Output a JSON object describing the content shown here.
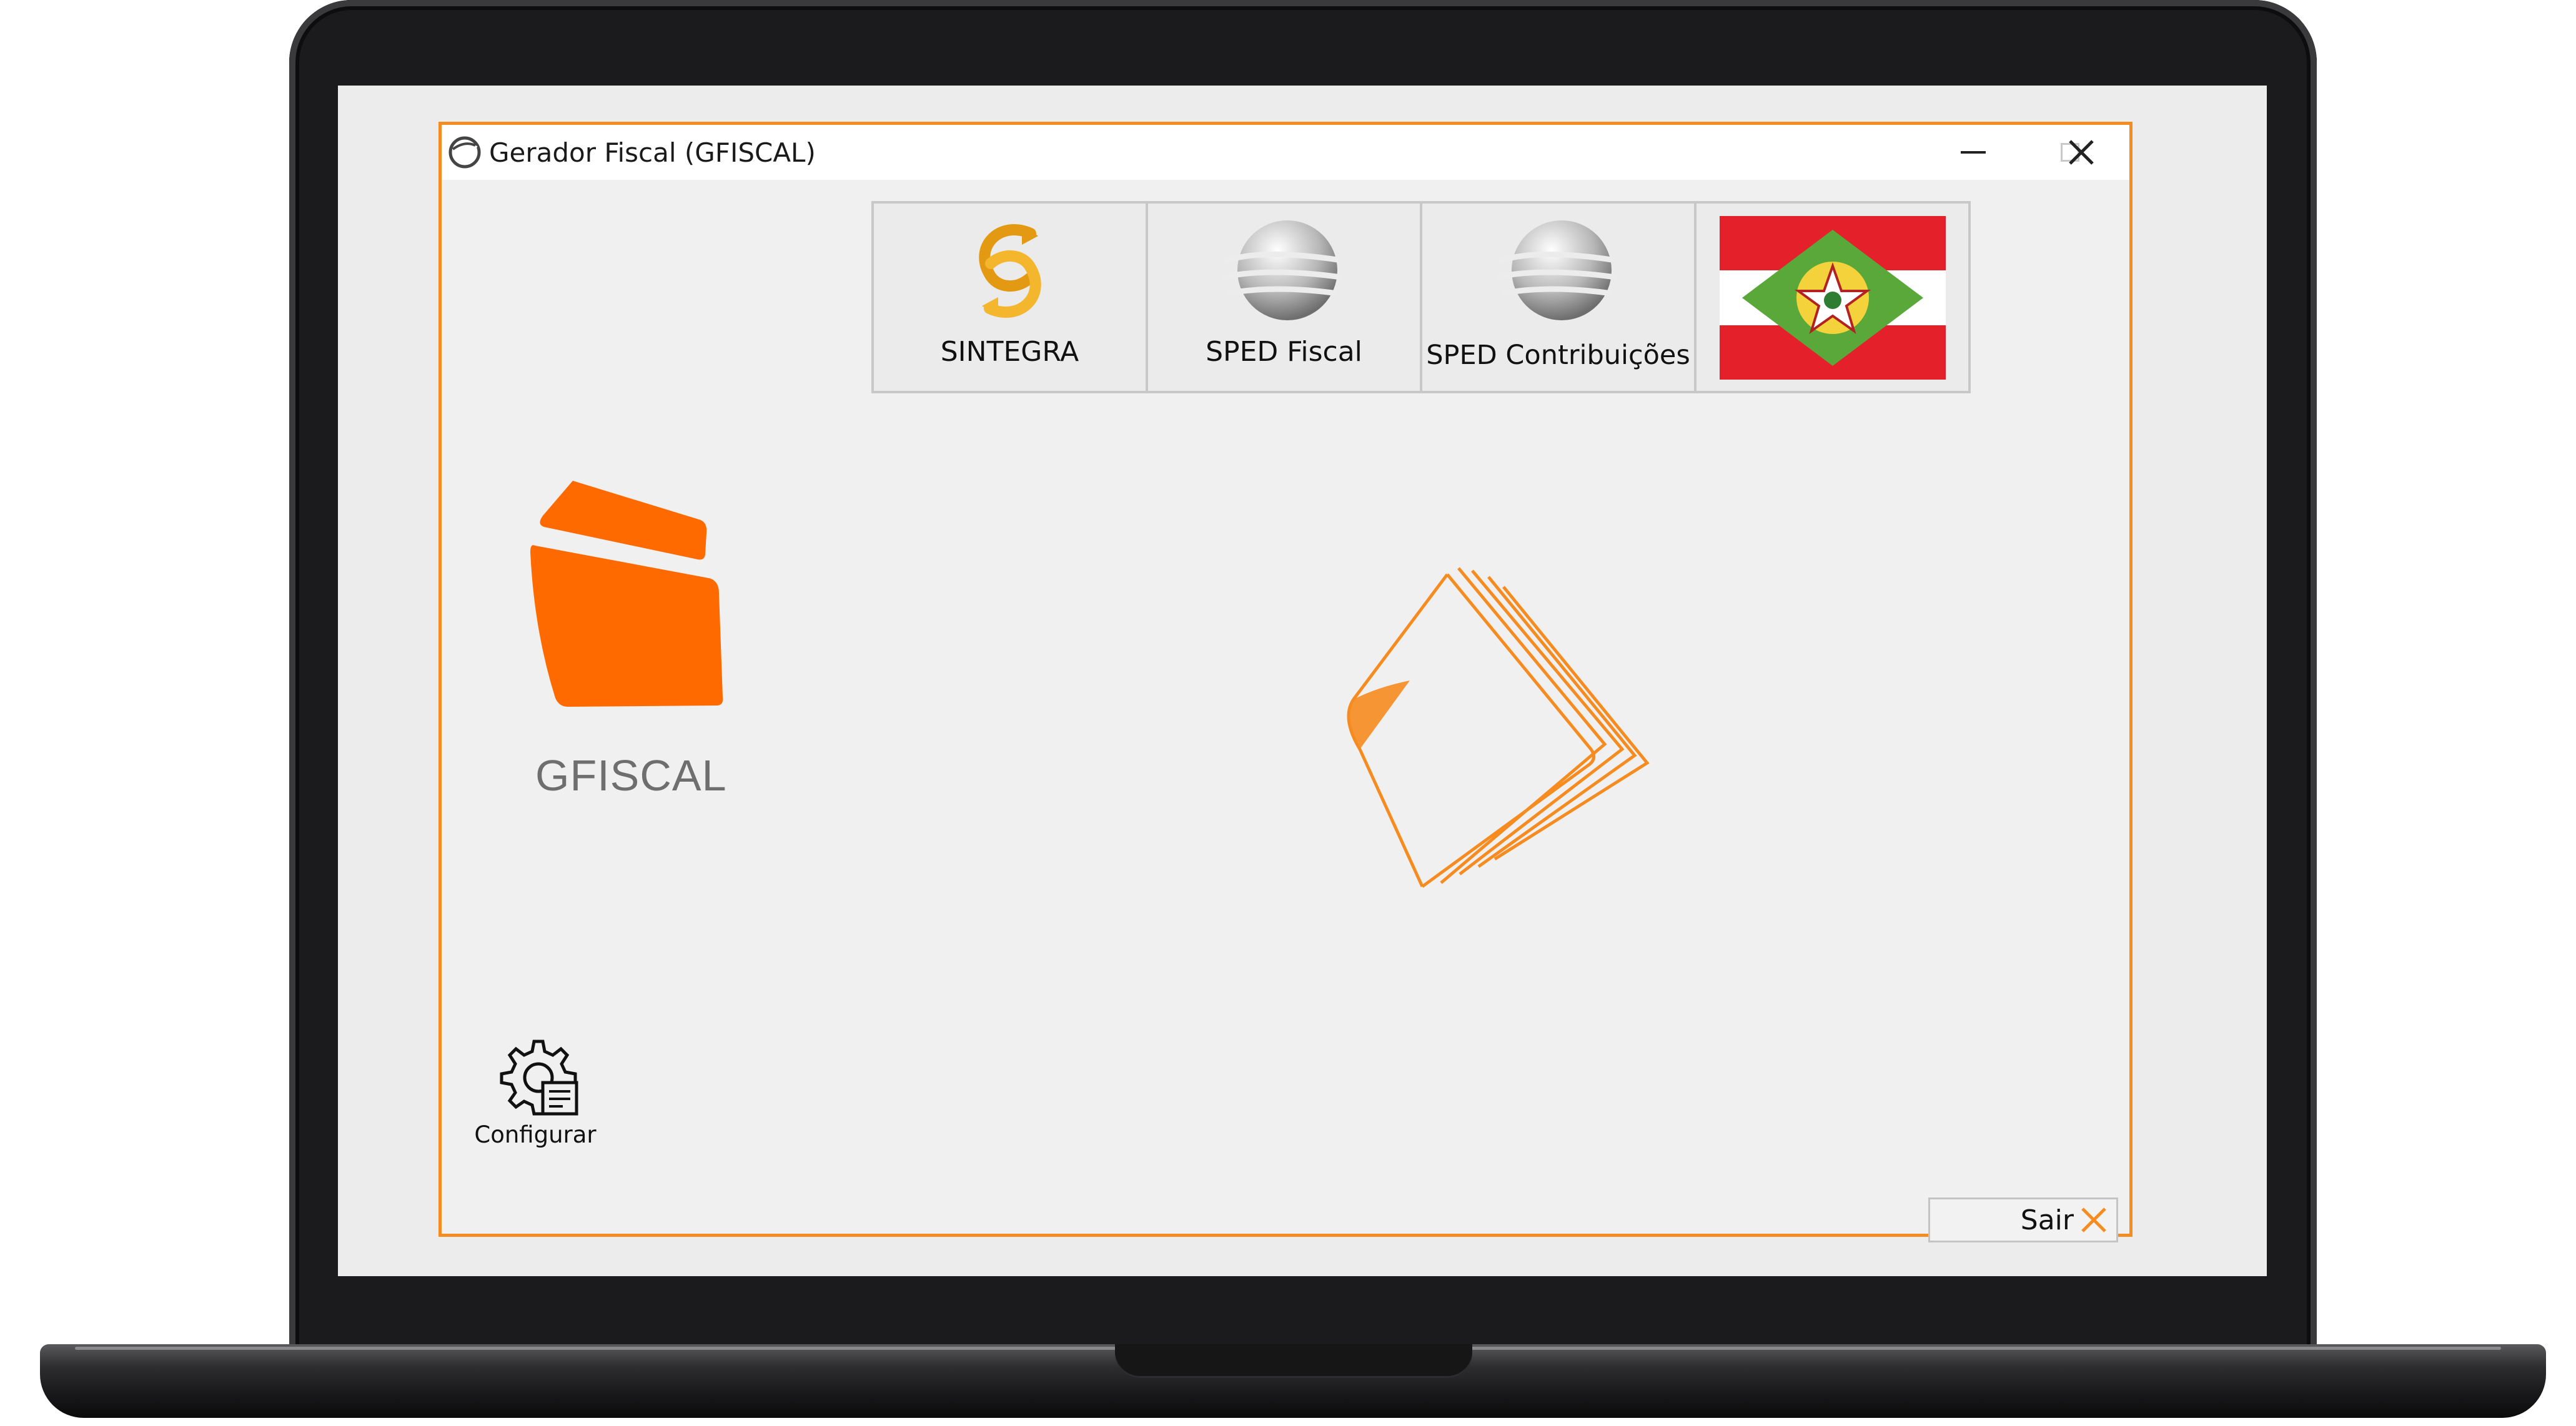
{
  "window": {
    "title": "Gerador Fiscal (GFISCAL)"
  },
  "toolbar": {
    "modules": [
      {
        "label": "SINTEGRA",
        "icon": "sintegra-icon"
      },
      {
        "label": "SPED Fiscal",
        "icon": "sped-globe-icon"
      },
      {
        "label": "SPED Contribuições",
        "icon": "sped-globe-icon"
      },
      {
        "label": "",
        "icon": "santa-catarina-flag-icon"
      }
    ]
  },
  "main": {
    "app_name": "GFISCAL",
    "configure_label": "Configurar",
    "exit_label": "Sair"
  },
  "colors": {
    "accent": "#f68b1f",
    "logo_orange": "#ff6a00",
    "flag_red": "#e4202b",
    "flag_green": "#5aa83a"
  }
}
